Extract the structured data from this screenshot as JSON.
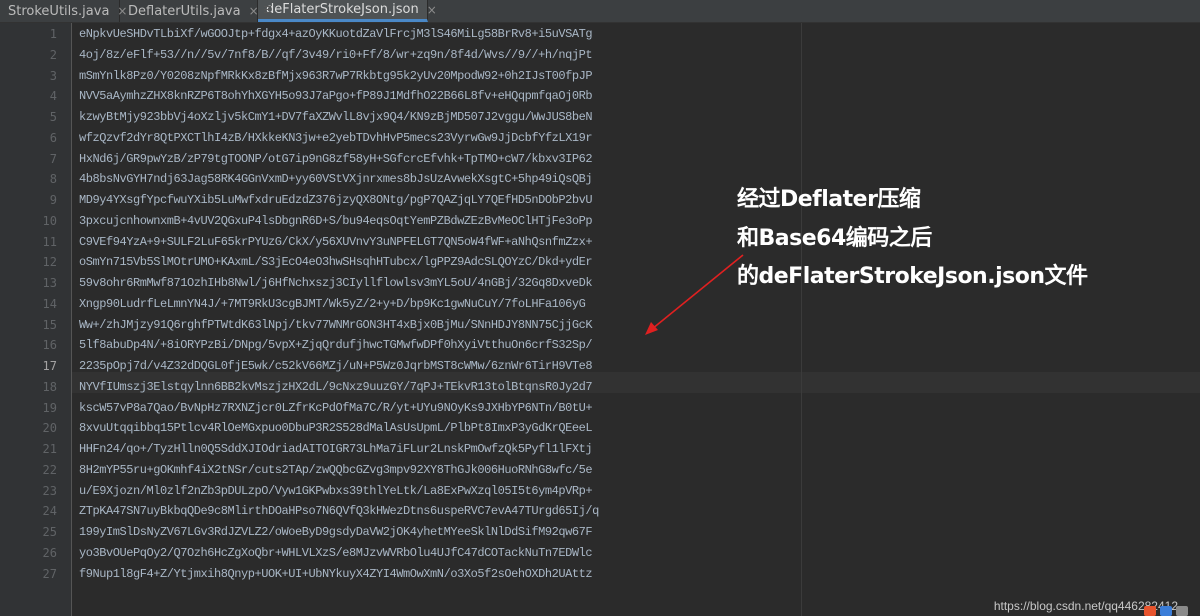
{
  "tabs": [
    {
      "label": "StrokeUtils.java",
      "icon": "java-file-icon",
      "active": false
    },
    {
      "label": "DeflaterUtils.java",
      "icon": "java-file-icon",
      "active": false
    },
    {
      "label": "deFlaterStrokeJson.json",
      "icon": "json-file-icon",
      "active": true
    }
  ],
  "editor": {
    "current_line": 17,
    "lines": [
      {
        "n": "1",
        "text": "eNpkvUeSHDvTLbiXf/wGOOJtp+fdgx4+azOyKKuotdZaVlFrcjM3lS46MiLg58BrRv8+i5uVSATg"
      },
      {
        "n": "2",
        "text": "4oj/8z/eFlf+53//n//5v/7nf8/B//qf/3v49/ri0+Ff/8/wr+zq9n/8f4d/Wvs//9//+h/nqjPt"
      },
      {
        "n": "3",
        "text": "mSmYnlk8Pz0/Y0208zNpfMRkKx8zBfMjx963R7wP7Rkbtg95k2yUv20MpodW92+0h2IJsT00fpJP"
      },
      {
        "n": "4",
        "text": "NVV5aAymhzZHX8knRZP6T8ohYhXGYH5o93J7aPgo+fP89J1MdfhO22B66L8fv+eHQqpmfqaOj0Rb"
      },
      {
        "n": "5",
        "text": "kzwyBtMjy923bbVj4oXzljv5kCmY1+DV7faXZWvlL8vjx9Q4/KN9zBjMD507J2vggu/WwJUS8beN"
      },
      {
        "n": "6",
        "text": "wfzQzvf2dYr8QtPXCTlhI4zB/HXkkeKN3jw+e2yebTDvhHvP5mecs23VyrwGw9JjDcbfYfzLX19r"
      },
      {
        "n": "7",
        "text": "HxNd6j/GR9pwYzB/zP79tgTOONP/otG7ip9nG8zf58yH+SGfcrcEfvhk+TpTMO+cW7/kbxv3IP62"
      },
      {
        "n": "8",
        "text": "4b8bsNvGYH7ndj63Jag58RK4GGnVxmD+yy60VStVXjnrxmes8bJsUzAvwekXsgtC+5hp49iQsQBj"
      },
      {
        "n": "9",
        "text": "MD9y4YXsgfYpcfwuYXib5LuMwfxdruEdzdZ376jzyQX8ONtg/pgP7QAZjqLY7QEfHD5nDObP2bvU"
      },
      {
        "n": "10",
        "text": "3pxcujcnhownxmB+4vUV2QGxuP4lsDbgnR6D+S/bu94eqsOqtYemPZBdwZEzBvMeOClHTjFe3oPp"
      },
      {
        "n": "11",
        "text": "C9VEf94YzA+9+SULF2LuF65krPYUzG/CkX/y56XUVnvY3uNPFELGT7QN5oW4fWF+aNhQsnfmZzx+"
      },
      {
        "n": "12",
        "text": "oSmYn715Vb5SlMOtrUMO+KAxmL/S3jEcO4eO3hwSHsqhHTubcx/lgPPZ9AdcSLQOYzC/Dkd+ydEr"
      },
      {
        "n": "13",
        "text": "59v8ohr6RmMwf871OzhIHb8Nwl/j6HfNchxszj3CIyllflowlsv3mYL5oU/4nGBj/32Gq8DxveDk"
      },
      {
        "n": "14",
        "text": "Xngp90LudrfLeLmnYN4J/+7MT9RkU3cgBJMT/Wk5yZ/2+y+D/bp9Kc1gwNuCuY/7foLHFa106yG"
      },
      {
        "n": "15",
        "text": "Ww+/zhJMjzy91Q6rghfPTWtdK63lNpj/tkv77WNMrGON3HT4xBjx0BjMu/SNnHDJY8NN75CjjGcK"
      },
      {
        "n": "16",
        "text": "5lf8abuDp4N/+8iORYPzBi/DNpg/5vpX+ZjqQrdufjhwcTGMwfwDPf0hXyiVtthuOn6crfS32Sp/"
      },
      {
        "n": "17",
        "text": "2235pOpj7d/v4Z32dDQGL0fjE5wk/c52kV66MZj/uN+P5Wz0JqrbMST8cWMw/6znWr6TirH9VTe8"
      },
      {
        "n": "18",
        "text": "NYVfIUmszj3Elstqylnn6BB2kvMszjzHX2dL/9cNxz9uuzGY/7qPJ+TEkvR13tolBtqnsR0Jy2d7"
      },
      {
        "n": "19",
        "text": "kscW57vP8a7Qao/BvNpHz7RXNZjcr0LZfrKcPdOfMa7C/R/yt+UYu9NOyKs9JXHbYP6NTn/B0tU+"
      },
      {
        "n": "20",
        "text": "8xvuUtqqibbq15Ptlcv4RlOeMGxpuo0DbuP3R2S528dMalAsUsUpmL/PlbPt8ImxP3yGdKrQEeeL"
      },
      {
        "n": "21",
        "text": "HHFn24/qo+/TyzHlln0Q5SddXJIOdriadAITOIGR73LhMa7iFLur2LnskPmOwfzQk5Pyfl1lFXtj"
      },
      {
        "n": "22",
        "text": "8H2mYP55ru+gOKmhf4iX2tNSr/cuts2TAp/zwQQbcGZvg3mpv92XY8ThGJk006HuoRNhG8wfc/5e"
      },
      {
        "n": "23",
        "text": "u/E9Xjozn/Ml0zlf2nZb3pDULzpO/Vyw1GKPwbxs39thlYeLtk/La8ExPwXzql05I5t6ym4pVRp+"
      },
      {
        "n": "24",
        "text": "ZTpKA47SN7uyBkbqQDe9c8MlirthDOaHPso7N6QVfQ3kHWezDtns6uspeRVC7evA47TUrgd65Ij/q"
      },
      {
        "n": "25",
        "text": "199yImSlDsNyZV67LGv3RdJZVLZ2/oWoeByD9gsdyDaVW2jOK4yhetMYeeSklNlDdSifM92qw67F"
      },
      {
        "n": "26",
        "text": "yo3BvOUePqOy2/Q7Ozh6HcZgXoQbr+WHLVLXzS/e8MJzvWVRbOlu4UJfC47dCOTackNuTn7EDWlc"
      },
      {
        "n": "27",
        "text": "f9Nup1l8gF4+Z/Ytjmxih8Qnyp+UOK+UI+UbNYkuyX4ZYI4WmOwXmN/o3Xo5f2sOehOXDh2UAttz"
      }
    ]
  },
  "annotation": {
    "line1": "经过Deflater压缩",
    "line2": "和Base64编码之后",
    "line3": "的deFlaterStrokeJson.json文件"
  },
  "watermark": "https://blog.csdn.net/qq446282412",
  "colors": {
    "editor_bg": "#2b2b2b",
    "gutter_bg": "#313335",
    "code_text": "#a9b7c6",
    "line_number": "#606366",
    "arrow": "#e02020",
    "tab_active_underline": "#4a88c7"
  }
}
